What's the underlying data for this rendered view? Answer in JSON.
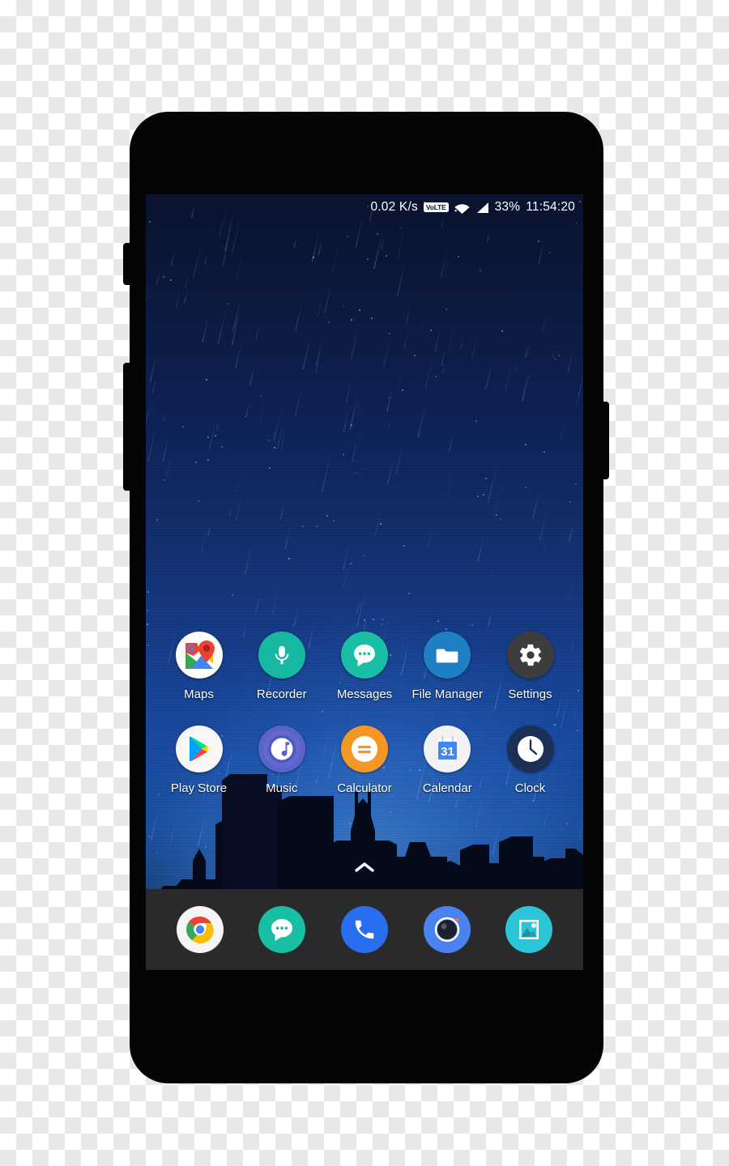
{
  "device": {
    "type": "smartphone",
    "frame_color": "#050505"
  },
  "status_bar": {
    "network_speed": "0.02 K/s",
    "volte_badge": "VoLTE",
    "wifi_icon": "wifi-icon",
    "signal_icon": "signal-bars-icon",
    "battery_percent": "33%",
    "clock": "11:54:20"
  },
  "home_screen": {
    "wallpaper": "night-city-skyline-rain",
    "rows": [
      {
        "apps": [
          {
            "label": "Maps",
            "icon": "google-maps-icon",
            "bg": "#ffffff"
          },
          {
            "label": "Recorder",
            "icon": "microphone-icon",
            "bg": "#16b8a2"
          },
          {
            "label": "Messages",
            "icon": "chat-bubble-icon",
            "bg": "#18bfa5"
          },
          {
            "label": "File Manager",
            "icon": "folder-icon",
            "bg": "#1f7fc4"
          },
          {
            "label": "Settings",
            "icon": "gear-icon",
            "bg": "#3d3d3d"
          }
        ]
      },
      {
        "apps": [
          {
            "label": "Play Store",
            "icon": "play-store-icon",
            "bg": "#f7f7f7"
          },
          {
            "label": "Music",
            "icon": "music-note-icon",
            "bg": "#5a63c8"
          },
          {
            "label": "Calculator",
            "icon": "equals-icon",
            "bg": "#f59725"
          },
          {
            "label": "Calendar",
            "icon": "calendar-31-icon",
            "bg": "#f2f2f2",
            "day": "31"
          },
          {
            "label": "Clock",
            "icon": "clock-icon",
            "bg": "#1c3055"
          }
        ]
      }
    ],
    "drawer_handle": "chevron-up-icon"
  },
  "dock": {
    "background": "#2a2a2c",
    "apps": [
      {
        "name": "Chrome",
        "icon": "chrome-icon",
        "bg": "#f5f5f5"
      },
      {
        "name": "Messages",
        "icon": "chat-bubble-icon",
        "bg": "#18bfa5"
      },
      {
        "name": "Phone",
        "icon": "phone-handset-icon",
        "bg": "#2a6ef0"
      },
      {
        "name": "Camera",
        "icon": "camera-lens-icon",
        "bg": "#4a82f0"
      },
      {
        "name": "Gallery",
        "icon": "photo-frame-icon",
        "bg": "#2cc5d8"
      }
    ]
  },
  "colors": {
    "sky_top": "#0a1330",
    "sky_mid": "#1a4da6",
    "dock_bg": "#2a2a2c",
    "label_text": "#ffffff"
  }
}
